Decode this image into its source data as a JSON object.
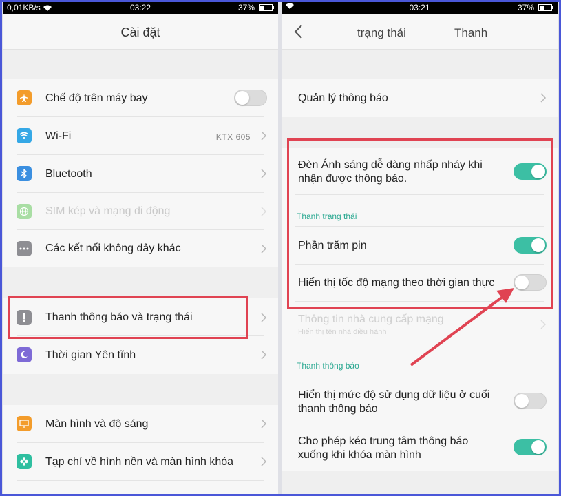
{
  "colors": {
    "accent": "#3cbfa4",
    "highlight": "#e04352",
    "frame": "#4a57d8"
  },
  "left": {
    "statusbar": {
      "network": "0,01KB/s",
      "time": "03:22",
      "battery": "37%"
    },
    "title": "Cài đặt",
    "items": [
      {
        "label": "Chế độ trên máy bay",
        "icon": "airplane-icon",
        "icon_color": "#f39c2b",
        "toggle": "off"
      },
      {
        "label": "Wi-Fi",
        "icon": "wifi-icon",
        "icon_color": "#35a8e6",
        "value": "KTX 605"
      },
      {
        "label": "Bluetooth",
        "icon": "bluetooth-icon",
        "icon_color": "#3b8fe0"
      },
      {
        "label": "SIM kép và mạng di động",
        "icon": "globe-icon",
        "icon_color": "#9fd99a",
        "disabled": true
      },
      {
        "label": "Các kết nối không dây khác",
        "icon": "more-icon",
        "icon_color": "#8e8e93"
      },
      {
        "label": "Thanh thông báo và trạng thái",
        "icon": "notification-icon",
        "icon_color": "#8e8e93",
        "highlighted": true
      },
      {
        "label": "Thời gian Yên tĩnh",
        "icon": "moon-icon",
        "icon_color": "#7e6ad6"
      },
      {
        "label": "Màn hình và độ sáng",
        "icon": "display-icon",
        "icon_color": "#f39c2b"
      },
      {
        "label": "Tạp chí về hình nền và màn hình khóa",
        "icon": "flower-icon",
        "icon_color": "#2fbfa0"
      }
    ]
  },
  "right": {
    "statusbar": {
      "time": "03:21",
      "battery": "37%"
    },
    "tabs": [
      "trạng thái",
      "Thanh"
    ],
    "items": {
      "manage": "Quản lý thông báo",
      "led_line1": "Đèn Ánh sáng dễ dàng nhấp nháy khi",
      "led_line2": "nhận được thông báo.",
      "status_header": "Thanh trạng thái",
      "battery_percent": "Phần trăm pin",
      "network_speed": "Hiển thị tốc độ mạng theo thời gian thực",
      "carrier": "Thông tin nhà cung cấp mạng",
      "carrier_sub": "Hiển thị tên nhà điều hành",
      "notif_header": "Thanh thông báo",
      "data_line1": "Hiển thị mức độ sử dụng dữ liệu ở cuối",
      "data_line2": "thanh thông báo",
      "pull_line1": "Cho phép kéo trung tâm thông báo",
      "pull_line2": "xuống khi khóa màn hình"
    },
    "toggles": {
      "led": "on",
      "battery_percent": "on",
      "network_speed": "off",
      "data_usage": "off",
      "pull_down": "on"
    }
  }
}
